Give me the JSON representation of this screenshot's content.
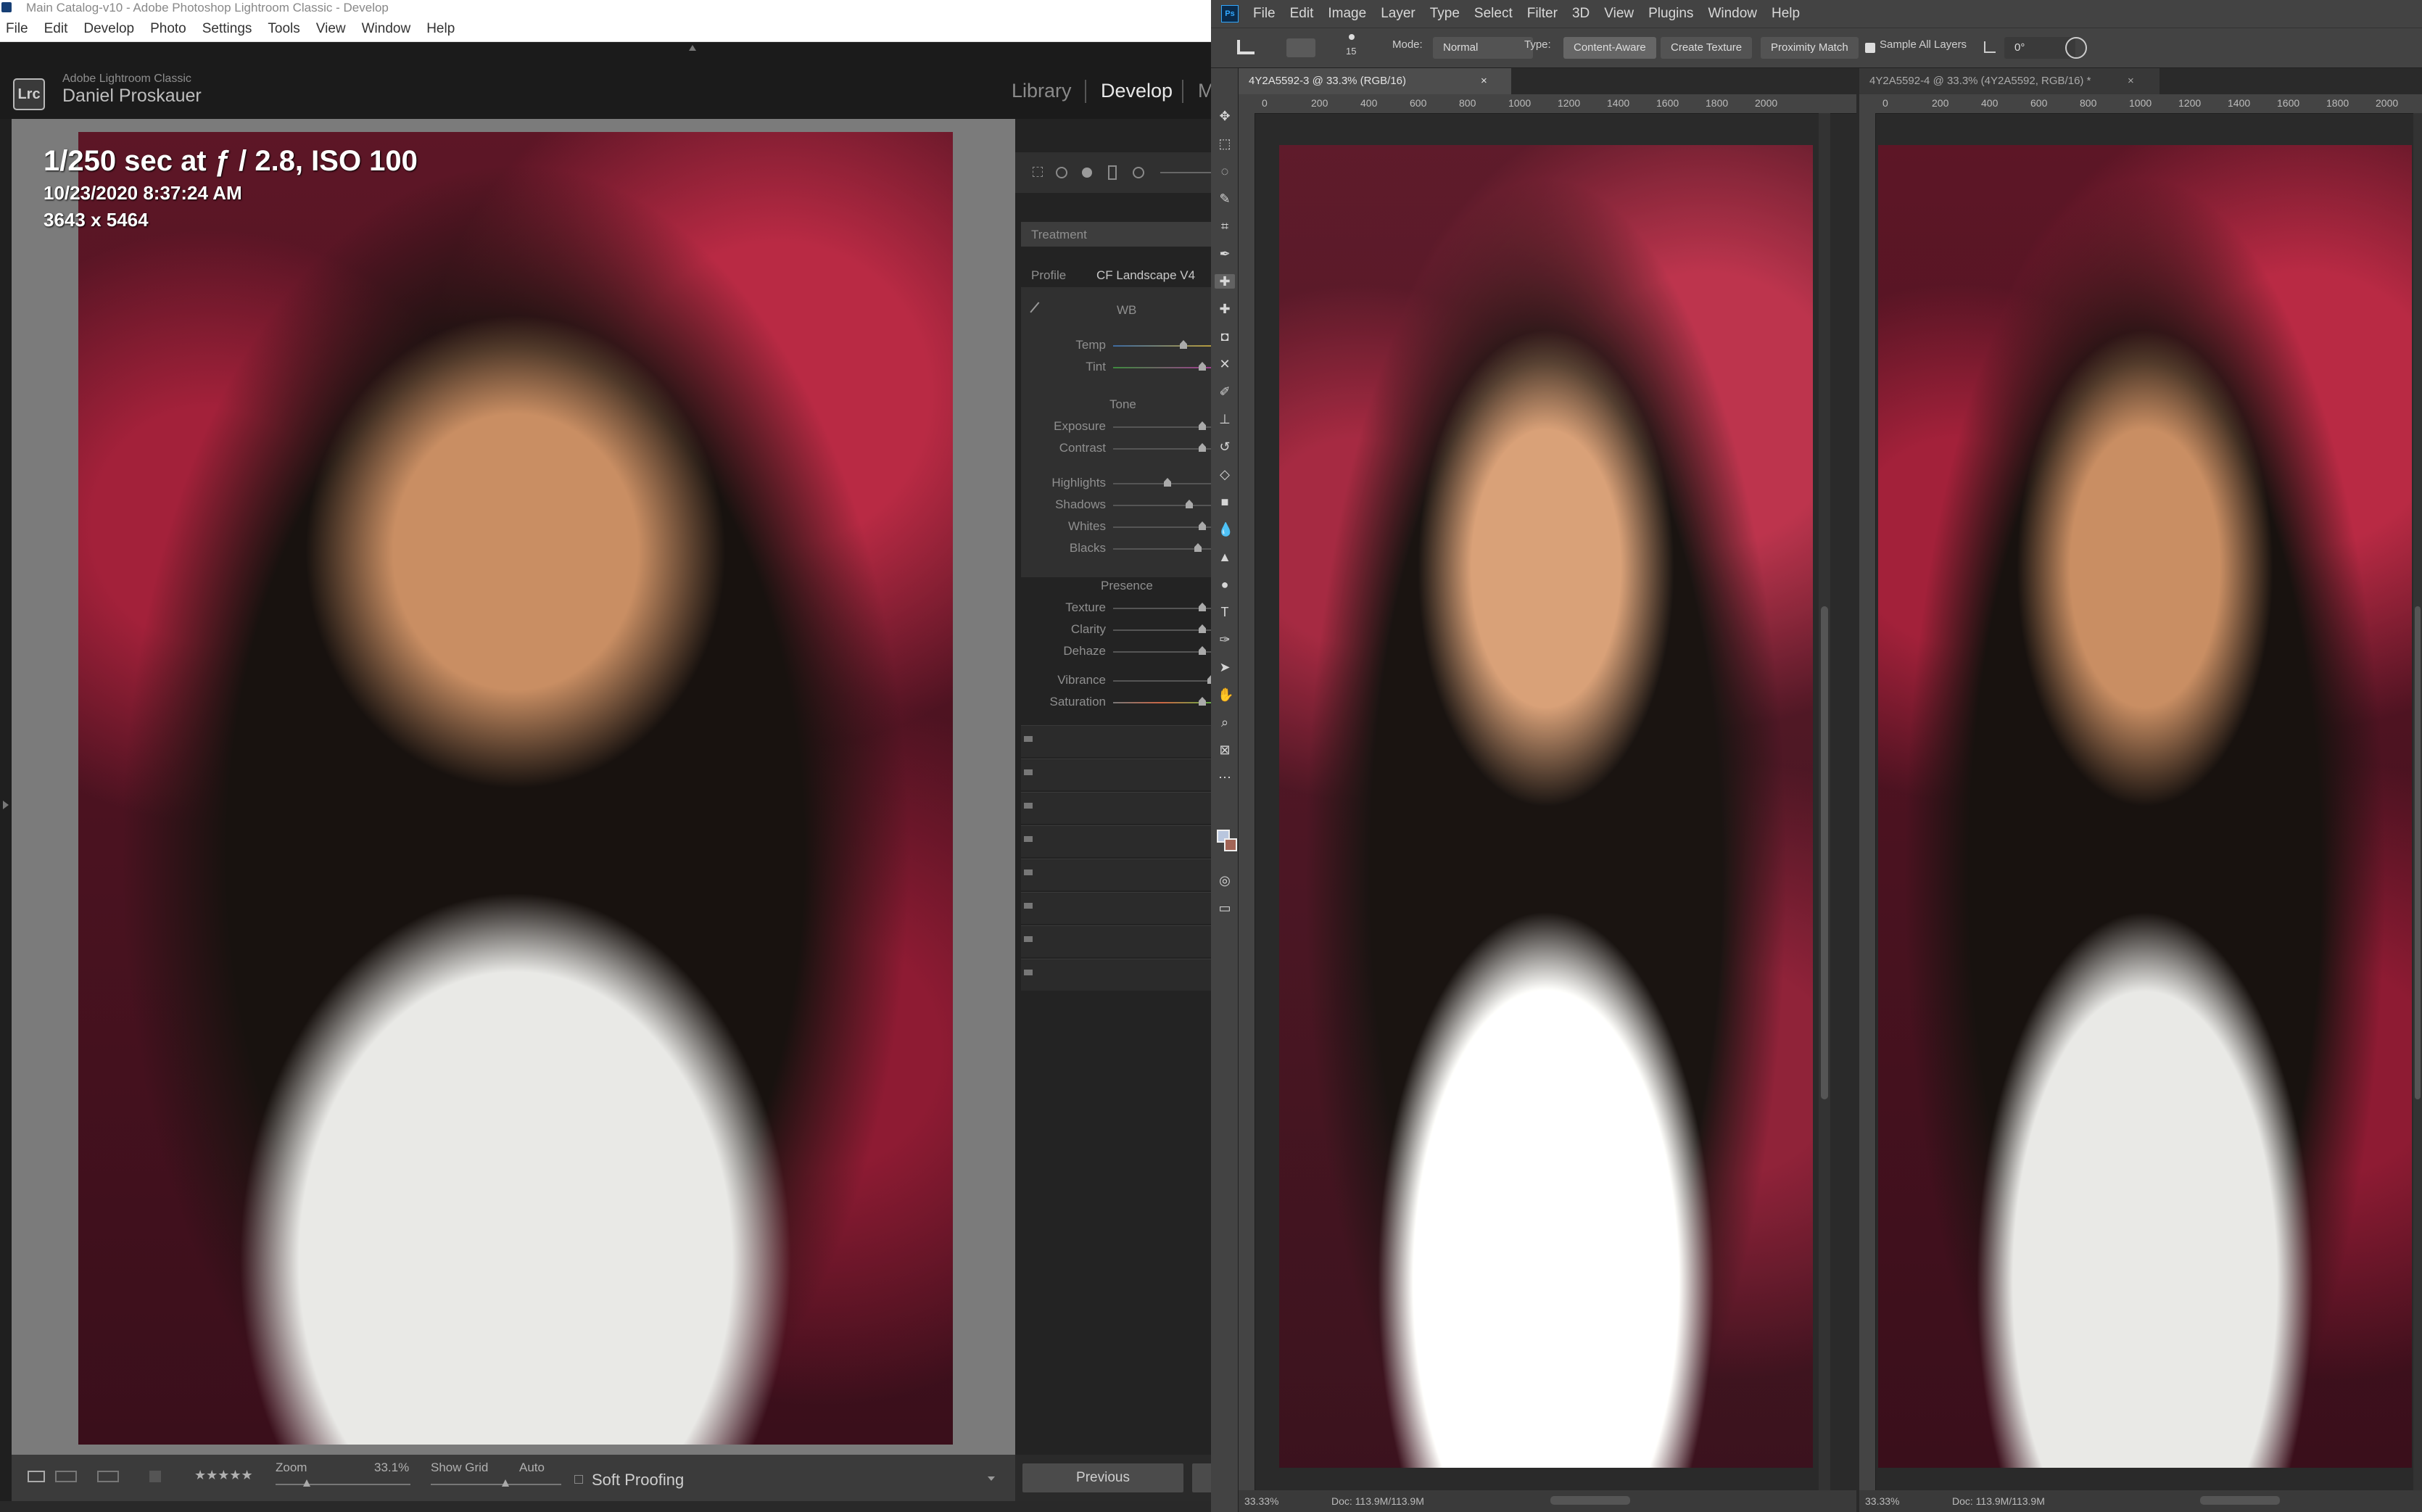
{
  "lightroom": {
    "window_title": "Main Catalog-v10 - Adobe Photoshop Lightroom Classic - Develop",
    "menu": [
      "File",
      "Edit",
      "Develop",
      "Photo",
      "Settings",
      "Tools",
      "View",
      "Window",
      "Help"
    ],
    "logo_text": "Lrc",
    "brand_line1": "Adobe Lightroom Classic",
    "brand_line2": "Daniel Proskauer",
    "modules": [
      "Library",
      "Develop",
      "M"
    ],
    "photo_info": {
      "line1": "1/250 sec at ƒ / 2.8, ISO 100",
      "line2": "10/23/2020 8:37:24 AM",
      "line3": "3643 x 5464"
    },
    "panel": {
      "treatment_label": "Treatment",
      "profile_label": "Profile",
      "profile_value": "CF Landscape V4",
      "wb_label": "WB",
      "temp_label": "Temp",
      "tint_label": "Tint",
      "tone_label": "Tone",
      "exposure_label": "Exposure",
      "contrast_label": "Contrast",
      "highlights_label": "Highlights",
      "shadows_label": "Shadows",
      "whites_label": "Whites",
      "blacks_label": "Blacks",
      "presence_label": "Presence",
      "texture_label": "Texture",
      "clarity_label": "Clarity",
      "dehaze_label": "Dehaze",
      "vibrance_label": "Vibrance",
      "saturation_label": "Saturation"
    },
    "toolbar": {
      "stars": "★★★★★",
      "zoom_label": "Zoom",
      "zoom_value": "33.1%",
      "show_grid_label": "Show Grid",
      "show_grid_value": "Auto",
      "soft_proofing_label": "Soft Proofing"
    },
    "previous_button": "Previous"
  },
  "photoshop": {
    "logo_text": "Ps",
    "menu": [
      "File",
      "Edit",
      "Image",
      "Layer",
      "Type",
      "Select",
      "Filter",
      "3D",
      "View",
      "Plugins",
      "Window",
      "Help"
    ],
    "options": {
      "brush_size": "15",
      "mode_label": "Mode:",
      "mode_value": "Normal",
      "type_label": "Type:",
      "type_options": [
        "Content-Aware",
        "Create Texture",
        "Proximity Match"
      ],
      "sample_all_layers": "Sample All Layers",
      "angle_value": "0°"
    },
    "doc1": {
      "tab": "4Y2A5592-3 @ 33.3% (RGB/16)",
      "close": "×",
      "ruler_labels": [
        "0",
        "200",
        "400",
        "600",
        "800",
        "1000",
        "1200",
        "1400",
        "1600",
        "1800",
        "2000"
      ],
      "zoom": "33.33%",
      "doc_size": "Doc: 113.9M/113.9M"
    },
    "doc2": {
      "tab": "4Y2A5592-4 @ 33.3% (4Y2A5592, RGB/16) *",
      "close": "×",
      "ruler_labels": [
        "0",
        "200",
        "400",
        "600",
        "800",
        "1000",
        "1200",
        "1400",
        "1600",
        "1800",
        "2000"
      ],
      "zoom": "33.33%",
      "doc_size": "Doc: 113.9M/113.9M"
    }
  }
}
